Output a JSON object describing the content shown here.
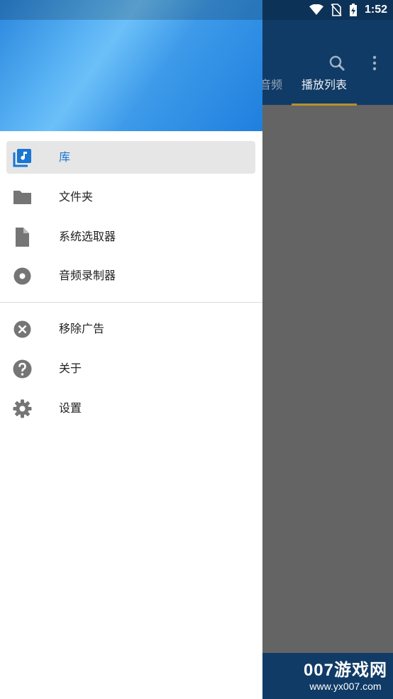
{
  "status_bar": {
    "time": "1:52"
  },
  "background_app": {
    "tabs": [
      {
        "label": "音频"
      },
      {
        "label": "播放列表"
      }
    ],
    "icons": [
      "search-icon",
      "more-vert-icon"
    ]
  },
  "drawer": {
    "primary_items": [
      {
        "label": "库",
        "icon": "library-music-icon",
        "selected": true
      },
      {
        "label": "文件夹",
        "icon": "folder-icon",
        "selected": false
      },
      {
        "label": "系统选取器",
        "icon": "file-icon",
        "selected": false
      },
      {
        "label": "音频录制器",
        "icon": "record-icon",
        "selected": false
      }
    ],
    "secondary_items": [
      {
        "label": "移除广告",
        "icon": "cancel-icon"
      },
      {
        "label": "关于",
        "icon": "help-icon"
      },
      {
        "label": "设置",
        "icon": "settings-icon"
      }
    ]
  },
  "watermark": {
    "title": "007游戏网",
    "url": "www.yx007.com"
  },
  "colors": {
    "accent": "#1976d2",
    "drawer_header_start": "#2a86dd",
    "drawer_header_end": "#1f7fde",
    "scrim": "#646464",
    "toolbar": "#103b66",
    "tab_indicator": "#b8902a",
    "icon_gray": "#757575"
  }
}
